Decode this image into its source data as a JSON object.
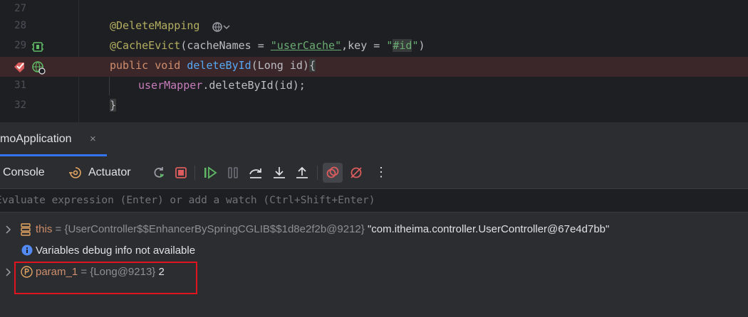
{
  "editor": {
    "lines": [
      {
        "num": "27"
      },
      {
        "num": "28",
        "annotation": "@DeleteMapping"
      },
      {
        "num": "29",
        "annotation": "@CacheEvict",
        "open": "(",
        "param1": "cacheNames = ",
        "str1": "\"userCache\"",
        "mid": ",key = ",
        "str2_open": "\"",
        "str2_hl": "#id",
        "str2_close": "\"",
        "close": ")"
      },
      {
        "kw1": "public",
        "kw2": "void",
        "method": "deleteById",
        "params": "(Long id)",
        "brace": "{"
      },
      {
        "num": "31",
        "field": "userMapper",
        "call": ".deleteById(id);"
      },
      {
        "num": "32",
        "brace": "}"
      }
    ]
  },
  "debug": {
    "tab_label": "moApplication",
    "tab_close": "×",
    "console_label": "Console",
    "actuator_label": "Actuator",
    "more_label": "⋮",
    "eval_placeholder": "Evaluate expression (Enter) or add a watch (Ctrl+Shift+Enter)"
  },
  "variables": {
    "this": {
      "name": "this",
      "eq": " = ",
      "type": "{UserController$$EnhancerBySpringCGLIB$$1d8e2f2b@9212}",
      "value": "\"com.itheima.controller.UserController@67e4d7bb\""
    },
    "info": "Variables debug info not available",
    "param": {
      "name": "param_1",
      "eq": " = ",
      "type": "{Long@9213}",
      "value": "2"
    }
  },
  "colors": {
    "accent": "#3574f0",
    "breakpoint": "#db5c5c",
    "highlight_box": "#e0141e"
  }
}
